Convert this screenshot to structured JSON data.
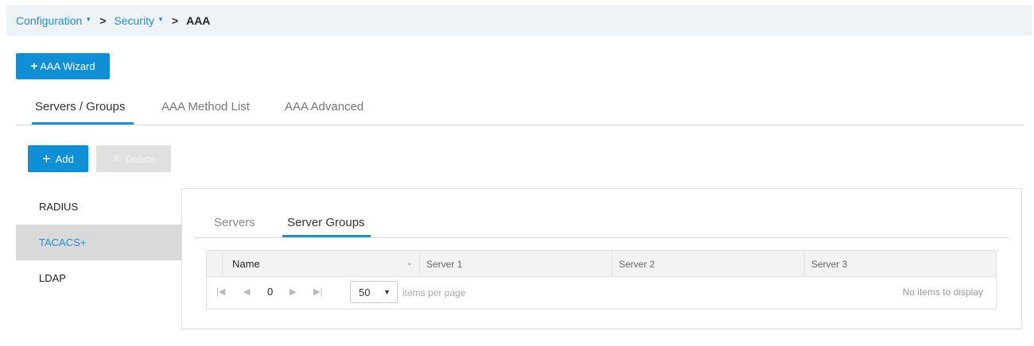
{
  "breadcrumb": {
    "items": [
      "Configuration",
      "Security"
    ],
    "current": "AAA"
  },
  "wizard_button": {
    "label": "AAA Wizard"
  },
  "main_tabs": [
    {
      "label": "Servers / Groups",
      "active": true
    },
    {
      "label": "AAA Method List",
      "active": false
    },
    {
      "label": "AAA Advanced",
      "active": false
    }
  ],
  "toolbar": {
    "add_label": "Add",
    "delete_label": "Delete"
  },
  "sidebar": {
    "items": [
      {
        "label": "RADIUS",
        "active": false
      },
      {
        "label": "TACACS+",
        "active": true
      },
      {
        "label": "LDAP",
        "active": false
      }
    ]
  },
  "inner_tabs": [
    {
      "label": "Servers",
      "active": false
    },
    {
      "label": "Server Groups",
      "active": true
    }
  ],
  "grid": {
    "columns": [
      "Name",
      "Server 1",
      "Server 2",
      "Server 3"
    ],
    "rows": []
  },
  "pager": {
    "page": "0",
    "page_size": "50",
    "items_per_page_label": "items per page",
    "empty_message": "No items to display"
  },
  "colors": {
    "accent": "#1f8fd1",
    "button": "#0f8fd6",
    "breadcrumb_bg": "#eef3f8",
    "selected_bg": "#d9d9d9"
  }
}
